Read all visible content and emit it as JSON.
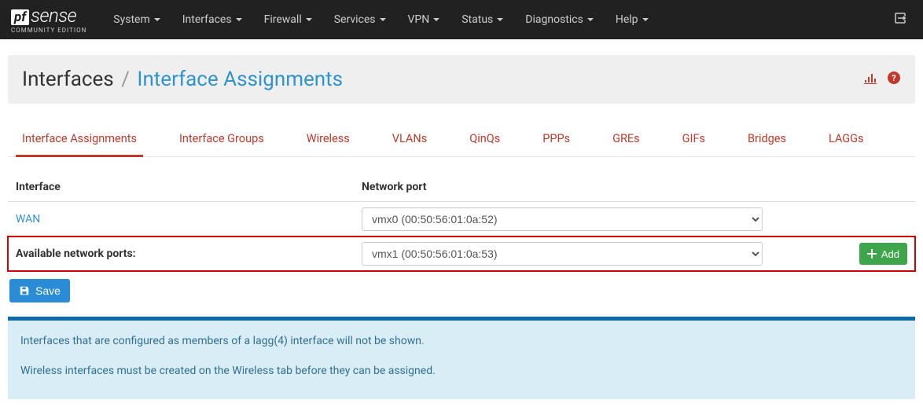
{
  "brand": {
    "pf": "pf",
    "sense": "sense",
    "edition": "COMMUNITY EDITION"
  },
  "nav": {
    "items": [
      "System",
      "Interfaces",
      "Firewall",
      "Services",
      "VPN",
      "Status",
      "Diagnostics",
      "Help"
    ]
  },
  "header": {
    "crumb_main": "Interfaces",
    "crumb_sep": "/",
    "crumb_sub": "Interface Assignments"
  },
  "tabs": [
    "Interface Assignments",
    "Interface Groups",
    "Wireless",
    "VLANs",
    "QinQs",
    "PPPs",
    "GREs",
    "GIFs",
    "Bridges",
    "LAGGs"
  ],
  "table": {
    "col_interface": "Interface",
    "col_port": "Network port",
    "rows": {
      "wan": {
        "name": "WAN",
        "port": "vmx0 (00:50:56:01:0a:52)"
      },
      "avail": {
        "label": "Available network ports:",
        "port": "vmx1 (00:50:56:01:0a:53)"
      }
    }
  },
  "buttons": {
    "add": "Add",
    "save": "Save"
  },
  "info": {
    "line1": "Interfaces that are configured as members of a lagg(4) interface will not be shown.",
    "line2": "Wireless interfaces must be created on the Wireless tab before they can be assigned."
  }
}
